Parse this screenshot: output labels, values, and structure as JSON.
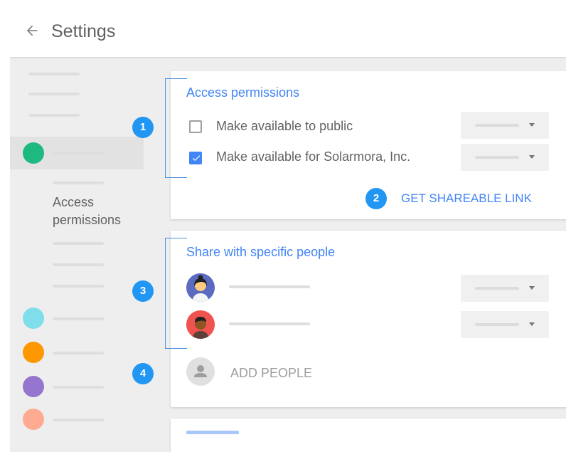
{
  "appbar": {
    "title": "Settings",
    "back_icon": "arrow-back-icon"
  },
  "sidebar": {
    "section_label_line1": "Access",
    "section_label_line2": "permissions",
    "dot_colors": [
      "#1eb980",
      "#80deea",
      "#ff9800",
      "#9575cd",
      "#ffab91"
    ]
  },
  "access_card": {
    "title": "Access permissions",
    "options": [
      {
        "label": "Make available to public",
        "checked": false
      },
      {
        "label": "Make available for Solarmora, Inc.",
        "checked": true
      }
    ],
    "link_label": "GET SHAREABLE LINK"
  },
  "share_card": {
    "title": "Share with specific people",
    "add_label": "ADD PEOPLE"
  },
  "badges": [
    "1",
    "2",
    "3",
    "4"
  ],
  "colors": {
    "accent": "#4285f4",
    "badge": "#2196f3",
    "background": "#eeeeee"
  }
}
